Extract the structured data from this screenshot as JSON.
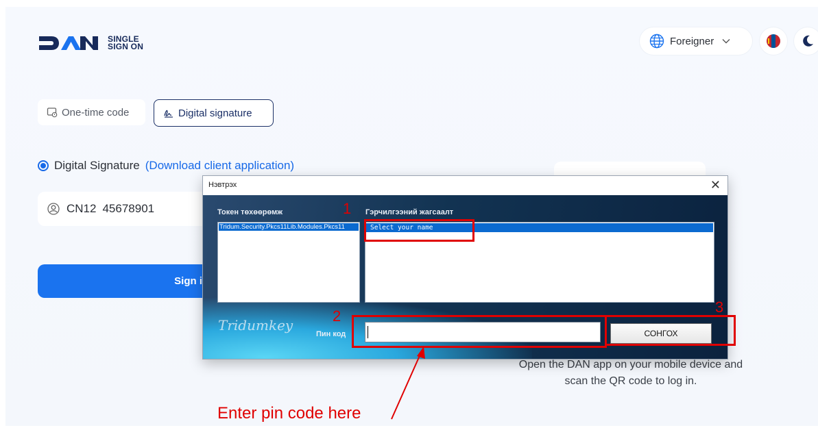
{
  "header": {
    "logo_text": "DAN",
    "logo_subtitle": "SINGLE SIGN ON",
    "language": "Foreigner",
    "icons": [
      "globe-icon",
      "chevron-down-icon",
      "mongolia-flag-icon",
      "moon-icon"
    ]
  },
  "tabs": [
    {
      "label": "One-time code",
      "icon": "device-code-icon",
      "active": false
    },
    {
      "label": "Digital signature",
      "icon": "signature-icon",
      "active": true
    }
  ],
  "method": {
    "label": "Digital Signature",
    "link": "(Download client application)"
  },
  "cn_field": {
    "prefix": "CN12",
    "value": "45678901"
  },
  "sign_button": "Sign i",
  "qr_hint": "Open the DAN app on your mobile device and scan the QR code to log in.",
  "dialog": {
    "title": "Нэвтрэх",
    "close": "✕",
    "token_header": "Токен төхөөрөмж",
    "token_items": [
      "Tridum.Security.Pkcs11Lib.Modules.Pkcs11"
    ],
    "cert_header": "Гэрчилгээний жагсаалт",
    "cert_items": [
      "Select your name"
    ],
    "brand": "Tridumkey",
    "pin_label": "Пин код",
    "pin_value": "",
    "choose_button": "СОНГОХ"
  },
  "annotations": {
    "step1": "1",
    "step2": "2",
    "step3": "3",
    "note": "Enter pin code here",
    "color": "#e00000"
  },
  "colors": {
    "primary": "#1a73ef",
    "brand_navy": "#172a5a",
    "dialog_bg": "#123352",
    "selection": "#0b6ad0"
  }
}
